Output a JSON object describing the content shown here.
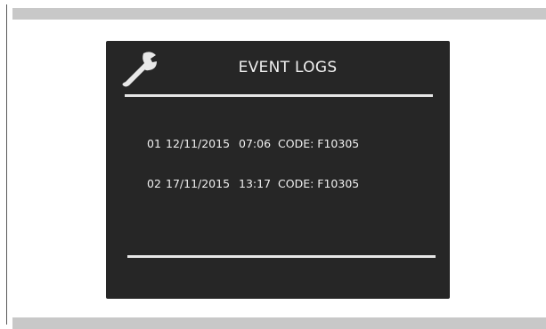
{
  "screen": {
    "title": "EVENT LOGS",
    "icon": "wrench-icon",
    "logs": [
      {
        "num": "01",
        "date": "12/11/2015",
        "time": "07:06",
        "code": "CODE: F10305"
      },
      {
        "num": "02",
        "date": "17/11/2015",
        "time": "13:17",
        "code": "CODE: F10305"
      }
    ]
  },
  "colors": {
    "screen_background": "#262626",
    "text": "#f0f0f0",
    "frame_bars": "#c8c8c8"
  }
}
